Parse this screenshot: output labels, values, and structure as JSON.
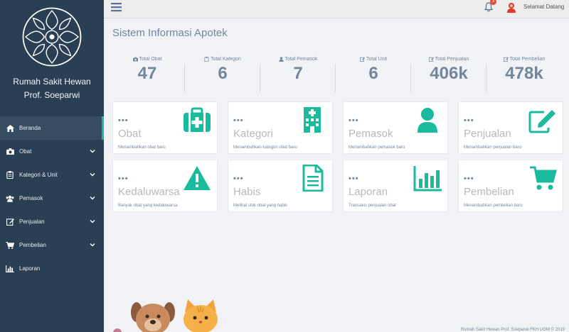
{
  "sidebar": {
    "brand_line1": "Rumah Sakit Hewan",
    "brand_line2": "Prof. Soeparwi",
    "items": [
      {
        "label": "Beranda",
        "icon": "home-icon",
        "active": true,
        "chevron": false
      },
      {
        "label": "Obat",
        "icon": "camera-icon",
        "active": false,
        "chevron": true
      },
      {
        "label": "Kategori & Unit",
        "icon": "clipboard-icon",
        "active": false,
        "chevron": true
      },
      {
        "label": "Pemasok",
        "icon": "users-icon",
        "active": false,
        "chevron": true
      },
      {
        "label": "Penjualan",
        "icon": "edit-icon",
        "active": false,
        "chevron": true
      },
      {
        "label": "Pembelian",
        "icon": "cart-icon",
        "active": false,
        "chevron": true
      },
      {
        "label": "Laporan",
        "icon": "bar-chart-icon",
        "active": false,
        "chevron": false
      }
    ]
  },
  "topbar": {
    "notification_count": "3",
    "greeting": "Selamat Datang"
  },
  "main": {
    "title": "Sistem Informasi Apotek",
    "stats": [
      {
        "label": "Total Obat",
        "value": "47",
        "icon": "camera-icon"
      },
      {
        "label": "Total Kategori",
        "value": "6",
        "icon": "clipboard-icon"
      },
      {
        "label": "Total Pemasok",
        "value": "7",
        "icon": "user-icon"
      },
      {
        "label": "Total Unit",
        "value": "6",
        "icon": "edit-icon"
      },
      {
        "label": "Total Penjualan",
        "value": "406k",
        "icon": "edit-icon"
      },
      {
        "label": "Total Pembelian",
        "value": "478k",
        "icon": "edit-icon"
      }
    ],
    "cards": [
      {
        "dots": "•••",
        "title": "Obat",
        "desc": "Menambahkan obat baru",
        "icon": "medkit-icon"
      },
      {
        "dots": "•••",
        "title": "Kategori",
        "desc": "Menambahkan kategori obat baru",
        "icon": "hospital-icon"
      },
      {
        "dots": "•••",
        "title": "Pemasok",
        "desc": "Menambahkan pemasok baru",
        "icon": "user-icon"
      },
      {
        "dots": "•••",
        "title": "Penjualan",
        "desc": "Menambahkan penjualan baru",
        "icon": "edit-icon"
      },
      {
        "dots": "•••",
        "title": "Kedaluwarsa",
        "desc": "Banyak obat yang kedaluwarsa",
        "icon": "warning-icon"
      },
      {
        "dots": "•••",
        "title": "Habis",
        "desc": "Melihat stok obat yang habis",
        "icon": "document-icon"
      },
      {
        "dots": "•••",
        "title": "Laporan",
        "desc": "Transaksi penjualan obat",
        "icon": "bar-chart-icon"
      },
      {
        "dots": "•••",
        "title": "Pembelian",
        "desc": "Menambahkan pembelian baru",
        "icon": "cart-icon"
      }
    ],
    "footer": "Rumah Sakit Hewan Prof. Soeparwi FKH UGM © 2019"
  },
  "colors": {
    "sidebar_bg": "#2a3f54",
    "accent": "#1abb9c",
    "text_muted": "#73879c"
  }
}
